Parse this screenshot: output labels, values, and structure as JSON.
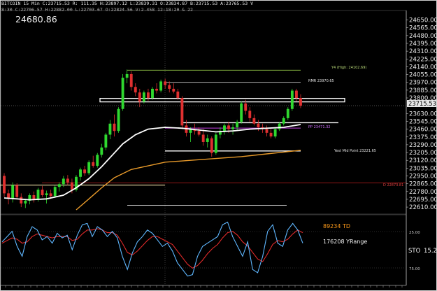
{
  "header": {
    "line1": "BITCOIN  15 Min  C:23715.53  R:   111.35  H:23897.12  L:23839.31  O:23834.87  B:23715.53  A:23765.53  V",
    "line2": "8:30  C:22706.57  H:22882.00  L:22703.67  O:22824.56  V:2.458  12:18:20 & 22"
  },
  "big_price": "24680.86",
  "current_price_label": "23715.53",
  "right_axis_ticks": [
    "24650.00",
    "24565.00",
    "24480.00",
    "24395.00",
    "24310.00",
    "24225.00",
    "24140.00",
    "24055.00",
    "23970.00",
    "23885.00",
    "23800.00",
    "23715.53",
    "23630.00",
    "23545.00",
    "23460.00",
    "23375.00",
    "23290.00",
    "23205.00",
    "23120.00",
    "23035.00",
    "22950.00",
    "22865.00",
    "22780.00",
    "22695.00",
    "22610.00"
  ],
  "annotations": {
    "yhigh": "Y4 (High: 24102.69)",
    "rmr": "RMR  23970.65",
    "pp": "PP  23471.32",
    "ymid": "Yest Mid Point  23221.65",
    "d_level": "D  22873.81"
  },
  "osc": {
    "label1": "89234 TD",
    "label2": "176208 YRange",
    "label3": "STO",
    "value": "15.2",
    "tick25": "25.00",
    "tick75": "75.00"
  },
  "colors": {
    "bull": "#2fd82f",
    "bear": "#e03030",
    "ma_fast": "#ffffff",
    "ma_slow": "#e89a2a",
    "osc_fast": "#5fb7ff",
    "osc_slow": "#e02a2a"
  },
  "chart_data": {
    "type": "candlestick",
    "instrument": "BITCOIN",
    "timeframe": "15 Min",
    "ylim": [
      22580,
      24700
    ],
    "levels": [
      {
        "name": "Y4 High",
        "value": 24102.69
      },
      {
        "name": "RMR",
        "value": 23970.65
      },
      {
        "name": "PP",
        "value": 23471.32
      },
      {
        "name": "Yest Mid Point",
        "value": 23221.65
      },
      {
        "name": "D",
        "value": 22873.81
      }
    ],
    "candles": [
      [
        22950,
        22980,
        22720,
        22760
      ],
      [
        22760,
        22800,
        22640,
        22700
      ],
      [
        22700,
        22880,
        22660,
        22850
      ],
      [
        22850,
        22870,
        22700,
        22720
      ],
      [
        22720,
        22760,
        22610,
        22650
      ],
      [
        22650,
        22700,
        22600,
        22680
      ],
      [
        22680,
        22760,
        22640,
        22740
      ],
      [
        22740,
        22780,
        22660,
        22690
      ],
      [
        22690,
        22820,
        22670,
        22800
      ],
      [
        22800,
        22840,
        22720,
        22740
      ],
      [
        22740,
        22790,
        22650,
        22760
      ],
      [
        22760,
        22800,
        22700,
        22730
      ],
      [
        22730,
        22850,
        22710,
        22830
      ],
      [
        22830,
        22880,
        22780,
        22860
      ],
      [
        22860,
        22950,
        22830,
        22920
      ],
      [
        22920,
        22960,
        22850,
        22880
      ],
      [
        22880,
        22920,
        22760,
        22800
      ],
      [
        22800,
        22960,
        22780,
        22940
      ],
      [
        22940,
        23040,
        22900,
        23020
      ],
      [
        23020,
        23060,
        22950,
        22980
      ],
      [
        22980,
        23120,
        22960,
        23100
      ],
      [
        23100,
        23170,
        23040,
        23060
      ],
      [
        23060,
        23200,
        23040,
        23180
      ],
      [
        23180,
        23300,
        23150,
        23260
      ],
      [
        23260,
        23420,
        23230,
        23400
      ],
      [
        23400,
        23560,
        23350,
        23520
      ],
      [
        23520,
        23620,
        23380,
        23440
      ],
      [
        23440,
        23700,
        23420,
        23680
      ],
      [
        23680,
        24060,
        23660,
        24020
      ],
      [
        24020,
        24110,
        23960,
        24060
      ],
      [
        24060,
        24090,
        23880,
        23920
      ],
      [
        23920,
        23960,
        23820,
        23860
      ],
      [
        23860,
        23900,
        23700,
        23760
      ],
      [
        23760,
        23880,
        23740,
        23860
      ],
      [
        23860,
        23900,
        23770,
        23800
      ],
      [
        23800,
        23920,
        23780,
        23900
      ],
      [
        23900,
        23960,
        23850,
        23880
      ],
      [
        23880,
        24000,
        23860,
        23980
      ],
      [
        23980,
        24010,
        23900,
        23940
      ],
      [
        23940,
        23980,
        23860,
        23900
      ],
      [
        23900,
        23960,
        23850,
        23870
      ],
      [
        23870,
        23900,
        23780,
        23800
      ],
      [
        23800,
        23820,
        23460,
        23500
      ],
      [
        23500,
        23560,
        23380,
        23420
      ],
      [
        23420,
        23480,
        23320,
        23460
      ],
      [
        23460,
        23520,
        23400,
        23440
      ],
      [
        23440,
        23480,
        23380,
        23400
      ],
      [
        23400,
        23460,
        23280,
        23320
      ],
      [
        23320,
        23400,
        23260,
        23360
      ],
      [
        23360,
        23380,
        23160,
        23200
      ],
      [
        23200,
        23420,
        23180,
        23400
      ],
      [
        23400,
        23480,
        23360,
        23440
      ],
      [
        23440,
        23520,
        23400,
        23500
      ],
      [
        23500,
        23540,
        23420,
        23460
      ],
      [
        23460,
        23520,
        23400,
        23480
      ],
      [
        23480,
        23560,
        23440,
        23540
      ],
      [
        23540,
        23760,
        23520,
        23740
      ],
      [
        23740,
        23780,
        23620,
        23660
      ],
      [
        23660,
        23700,
        23540,
        23580
      ],
      [
        23580,
        23620,
        23500,
        23520
      ],
      [
        23520,
        23560,
        23440,
        23480
      ],
      [
        23480,
        23520,
        23420,
        23460
      ],
      [
        23460,
        23500,
        23380,
        23420
      ],
      [
        23420,
        23460,
        23360,
        23380
      ],
      [
        23380,
        23480,
        23360,
        23460
      ],
      [
        23460,
        23540,
        23440,
        23520
      ],
      [
        23520,
        23600,
        23500,
        23580
      ],
      [
        23580,
        23700,
        23560,
        23680
      ],
      [
        23680,
        23900,
        23660,
        23880
      ],
      [
        23880,
        23900,
        23760,
        23800
      ],
      [
        23800,
        23840,
        23690,
        23715.53
      ]
    ],
    "ma_fast": [
      [
        0,
        22710
      ],
      [
        6,
        22690
      ],
      [
        10,
        22700
      ],
      [
        14,
        22740
      ],
      [
        17,
        22820
      ],
      [
        20,
        22920
      ],
      [
        23,
        23050
      ],
      [
        26,
        23200
      ],
      [
        28,
        23300
      ],
      [
        31,
        23400
      ],
      [
        34,
        23460
      ],
      [
        38,
        23480
      ],
      [
        42,
        23470
      ],
      [
        46,
        23450
      ],
      [
        50,
        23430
      ],
      [
        54,
        23440
      ],
      [
        58,
        23460
      ],
      [
        62,
        23470
      ],
      [
        66,
        23480
      ],
      [
        70,
        23510
      ]
    ],
    "ma_slow": [
      [
        17,
        22580
      ],
      [
        20,
        22700
      ],
      [
        23,
        22820
      ],
      [
        26,
        22930
      ],
      [
        30,
        23020
      ],
      [
        34,
        23060
      ],
      [
        38,
        23100
      ],
      [
        44,
        23120
      ],
      [
        50,
        23140
      ],
      [
        56,
        23160
      ],
      [
        62,
        23190
      ],
      [
        66,
        23210
      ],
      [
        70,
        23230
      ]
    ],
    "osc_fast": [
      62,
      70,
      78,
      55,
      40,
      70,
      85,
      80,
      65,
      70,
      60,
      75,
      68,
      72,
      50,
      72,
      88,
      90,
      70,
      85,
      80,
      70,
      78,
      68,
      40,
      20,
      45,
      62,
      70,
      80,
      75,
      65,
      55,
      60,
      48,
      30,
      20,
      10,
      12,
      40,
      55,
      60,
      65,
      70,
      88,
      92,
      70,
      55,
      40,
      62,
      20,
      15,
      40,
      78,
      88,
      60,
      55,
      80,
      90,
      80,
      60
    ],
    "osc_slow": [
      60,
      64,
      68,
      66,
      60,
      62,
      70,
      74,
      72,
      70,
      68,
      70,
      70,
      70,
      64,
      66,
      74,
      80,
      80,
      82,
      80,
      76,
      76,
      72,
      60,
      46,
      42,
      48,
      56,
      64,
      70,
      70,
      66,
      62,
      58,
      48,
      38,
      28,
      22,
      26,
      34,
      44,
      52,
      58,
      68,
      76,
      78,
      72,
      62,
      56,
      46,
      36,
      32,
      44,
      58,
      64,
      62,
      66,
      74,
      80,
      76
    ]
  }
}
